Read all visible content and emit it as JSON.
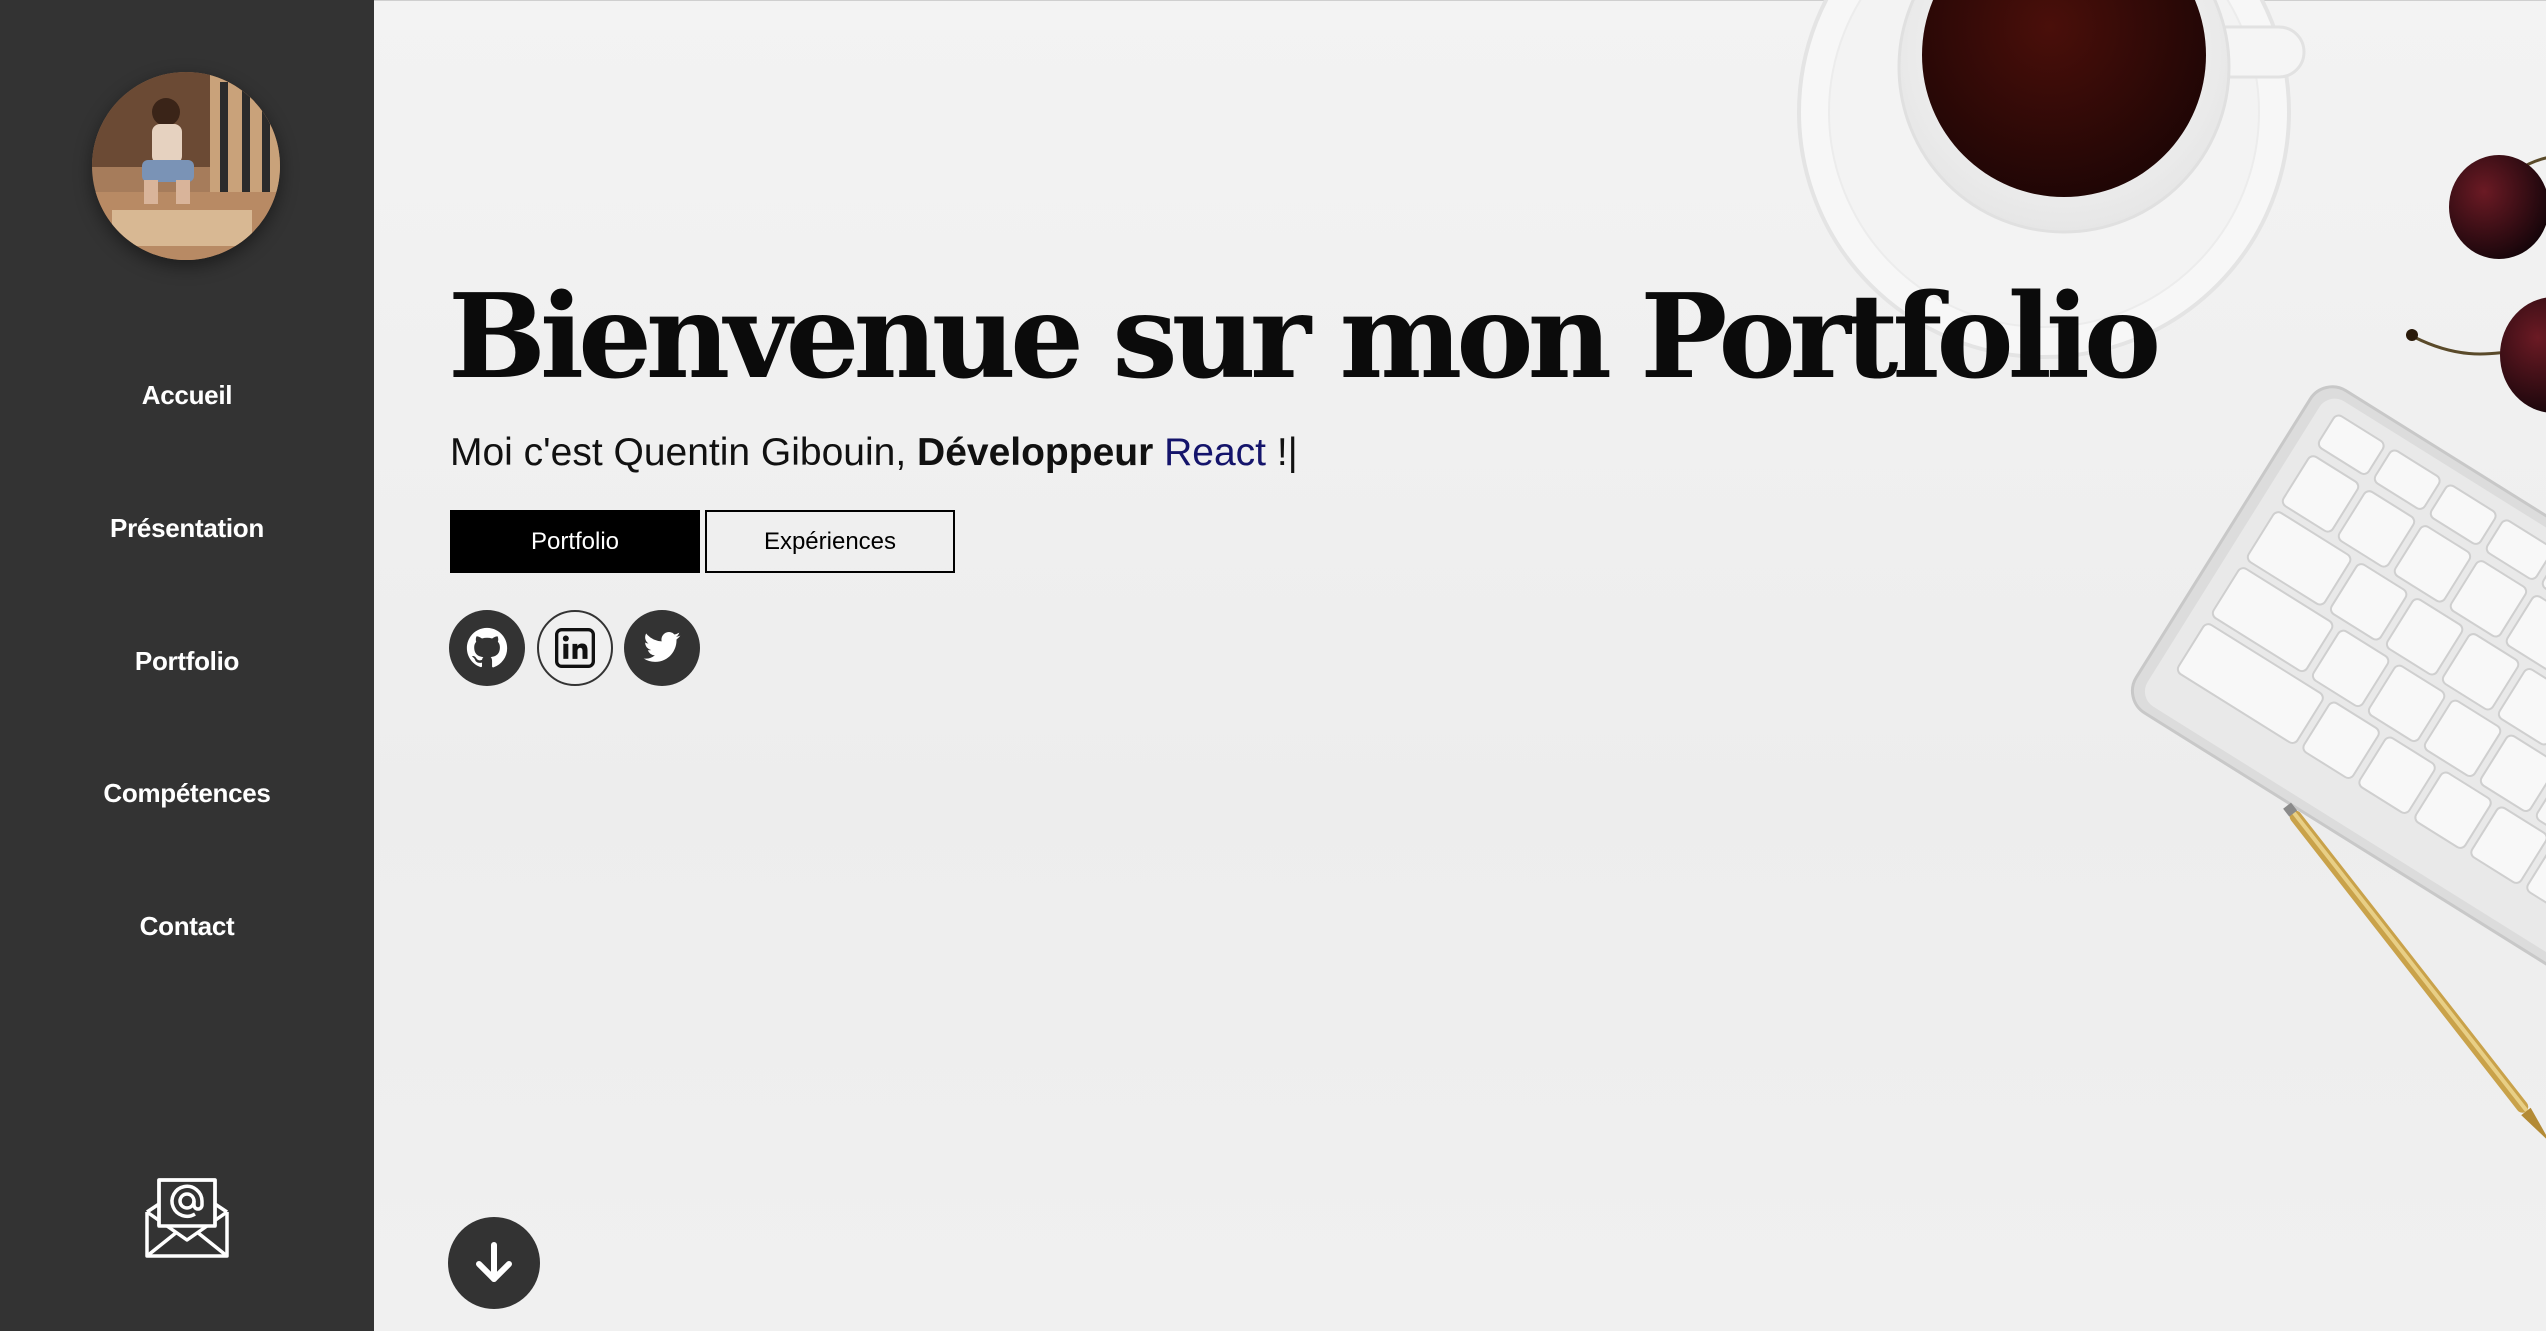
{
  "sidebar": {
    "items": [
      {
        "label": "Accueil"
      },
      {
        "label": "Présentation"
      },
      {
        "label": "Portfolio"
      },
      {
        "label": "Compétences"
      },
      {
        "label": "Contact"
      }
    ],
    "mail_icon": "envelope-at-icon"
  },
  "hero": {
    "title": "Bienvenue sur mon Portfolio",
    "subtitle_prefix": "Moi c'est Quentin Gibouin,",
    "subtitle_role": "Développeur",
    "subtitle_tech": "React",
    "subtitle_suffix": "!|",
    "buttons": {
      "primary": "Portfolio",
      "secondary": "Expériences"
    },
    "socials": [
      {
        "icon": "github-icon"
      },
      {
        "icon": "linkedin-icon"
      },
      {
        "icon": "twitter-icon"
      }
    ],
    "scroll_icon": "arrow-down-icon"
  },
  "colors": {
    "sidebar_bg": "#333333",
    "page_bg": "#efefef",
    "accent_text": "#14146b",
    "button_primary": "#000000"
  }
}
